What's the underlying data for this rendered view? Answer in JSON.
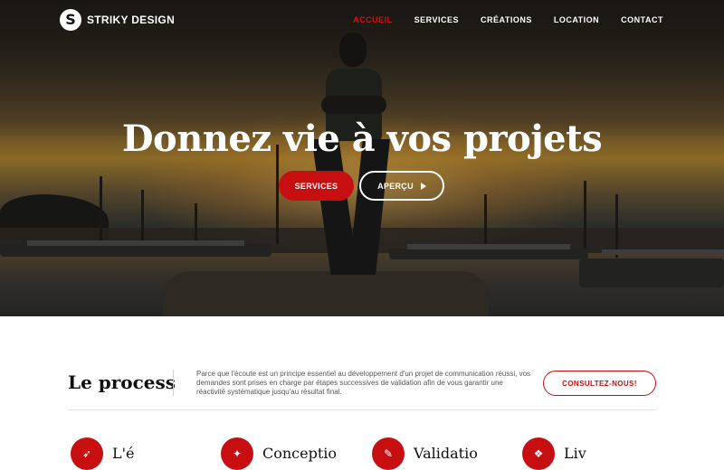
{
  "brand": {
    "name": "STRIKY DESIGN",
    "logo_letter": "S"
  },
  "nav": {
    "items": [
      {
        "label": "ACCUEIL",
        "active": true
      },
      {
        "label": "SERVICES",
        "active": false
      },
      {
        "label": "CRÉATIONS",
        "active": false
      },
      {
        "label": "LOCATION",
        "active": false
      },
      {
        "label": "CONTACT",
        "active": false
      }
    ]
  },
  "hero": {
    "title": "Donnez vie à vos projets",
    "primary_button": "SERVICES",
    "secondary_button": "APERÇU"
  },
  "process": {
    "title": "Le process",
    "description": "Parce que l'écoute est un principe essentiel au développement d'un projet de communication réussi, vos demandes sont prises en charge par étapes successives de validation afin de vous garantir une réactivité systématique jusqu'au résultat final.",
    "cta": "CONSULTEZ-NOUS!",
    "steps": [
      {
        "label": "L'é",
        "icon": "rocket-icon"
      },
      {
        "label": "Conceptio",
        "icon": "sparkle-icon"
      },
      {
        "label": "Validatio",
        "icon": "pencil-icon"
      },
      {
        "label": "Liv",
        "icon": "gift-icon"
      }
    ]
  },
  "colors": {
    "accent": "#c70f12",
    "text": "#111111"
  }
}
